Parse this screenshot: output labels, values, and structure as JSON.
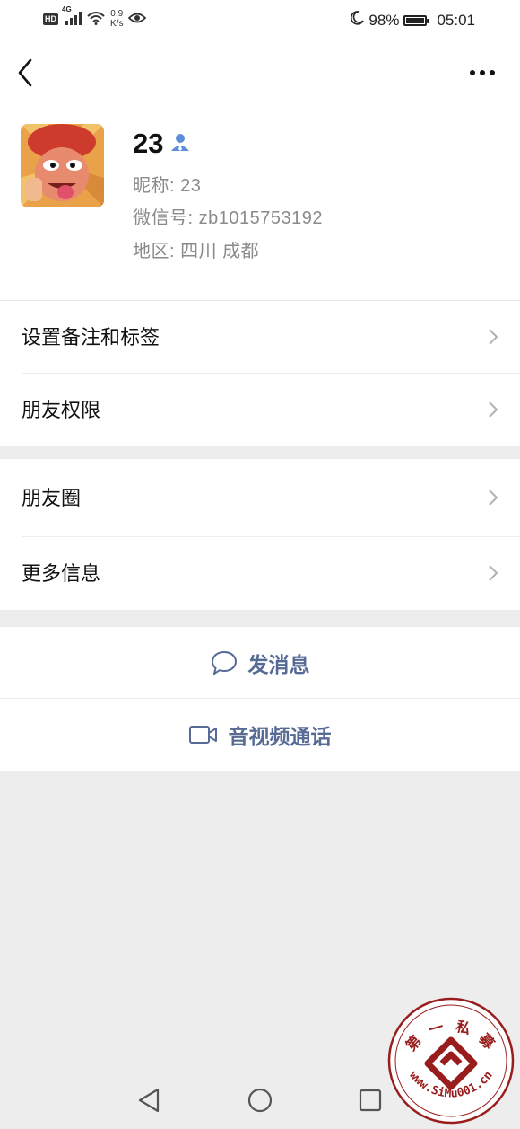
{
  "status_bar": {
    "hd": "HD",
    "network": "4G",
    "speed_value": "0.9",
    "speed_unit": "K/s",
    "battery_percent": "98%",
    "battery_level": 0.98,
    "time": "05:01"
  },
  "profile": {
    "name": "23",
    "nickname": "昵称:  23",
    "wechat_id": "微信号:  zb1015753192",
    "region": "地区:  四川  成都"
  },
  "menu": {
    "remark_tags": "设置备注和标签",
    "friend_permissions": "朋友权限",
    "moments": "朋友圈",
    "more_info": "更多信息"
  },
  "actions": {
    "send_message": "发消息",
    "video_call": "音视频通话"
  },
  "watermark": {
    "text_top": "第 一 私 募",
    "text_bottom": "www.SiMu001.cn",
    "color": "#9a1d1d"
  },
  "colors": {
    "link": "#576b95",
    "background": "#ededed"
  }
}
